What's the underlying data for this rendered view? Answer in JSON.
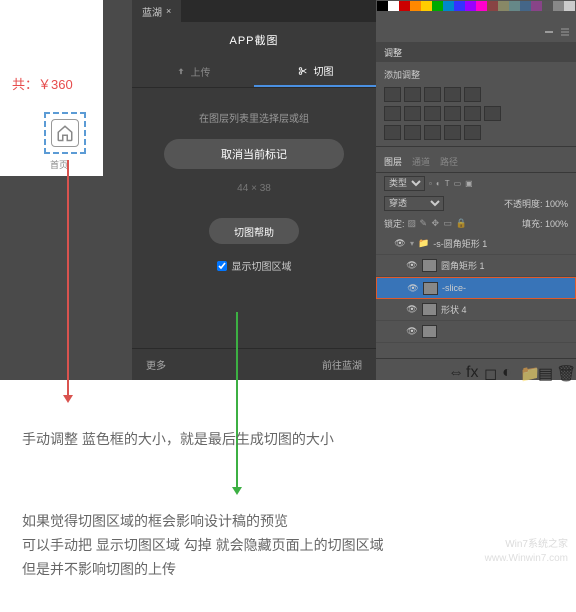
{
  "artboard": {
    "price_text": "共：￥360",
    "icon_label": "首页"
  },
  "lanhu": {
    "tab": "蓝湖",
    "subtitle": "APP截图",
    "mode_upload": "上传",
    "mode_cut": "切图",
    "hint": "在图层列表里选择层或组",
    "cancel_btn": "取消当前标记",
    "dims": "44  ×  38",
    "help_btn": "切图帮助",
    "show_area": "显示切图区域",
    "footer_more": "更多",
    "footer_goto": "前往蓝湖"
  },
  "ps": {
    "adjust_tab": "调整",
    "add_adjust": "添加调整",
    "layers_tab": "图层",
    "channels_tab": "通道",
    "paths_tab": "路径",
    "blend_passthrough": "穿透",
    "opacity_label": "不透明度:",
    "opacity_value": "100%",
    "lock_label": "锁定:",
    "fill_label": "填充:",
    "fill_value": "100%",
    "layers": {
      "group": "-s-圆角矩形 1",
      "rect": "圆角矩形 1",
      "slice": "-slice-",
      "shape4": "形状 4",
      "layer5": ""
    }
  },
  "captions": {
    "c1": "手动调整 蓝色框的大小，就是最后生成切图的大小",
    "c2a": "如果觉得切图区域的框会影响设计稿的预览",
    "c2b": "可以手动把 显示切图区域 勾掉 就会隐藏页面上的切图区域",
    "c2c": "但是并不影响切图的上传"
  },
  "watermark": {
    "line1": "Win7系统之家",
    "line2": "www.Winwin7.com"
  },
  "swatches": [
    "#000",
    "#fff",
    "#c00",
    "#f80",
    "#fc0",
    "#0a0",
    "#08c",
    "#33f",
    "#90f",
    "#f0c",
    "#844",
    "#886",
    "#688",
    "#468",
    "#848",
    "#555",
    "#888",
    "#ccc"
  ]
}
